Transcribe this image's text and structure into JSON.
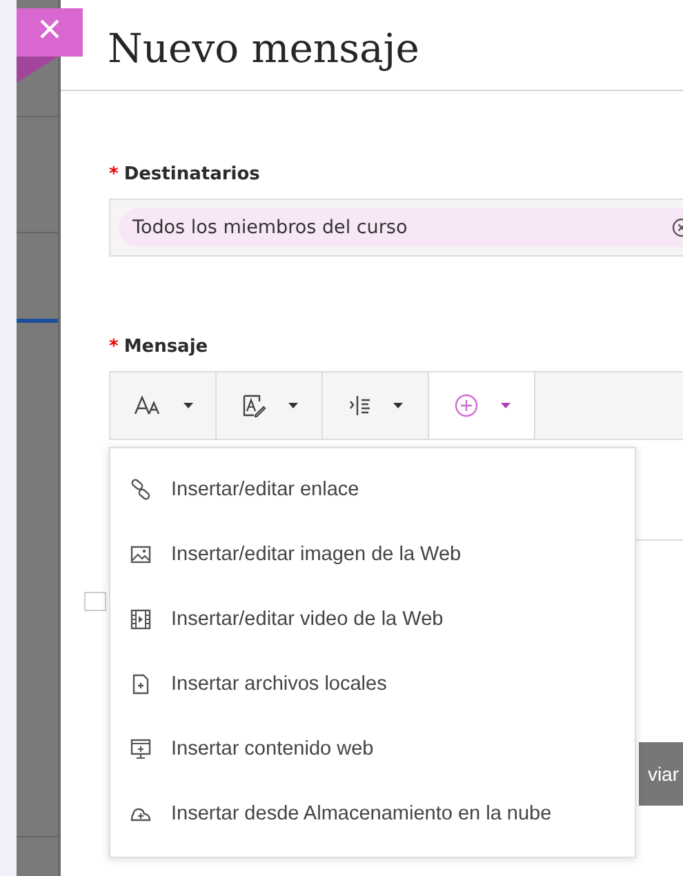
{
  "dialog": {
    "title": "Nuevo mensaje"
  },
  "recipients": {
    "label": "Destinatarios",
    "required_mark": "*",
    "chips": [
      {
        "text": "Todos los miembros del curso"
      }
    ]
  },
  "message": {
    "label": "Mensaje",
    "required_mark": "*"
  },
  "toolbar": {
    "groups": [
      {
        "kind": "font",
        "selected": false
      },
      {
        "kind": "style",
        "selected": false
      },
      {
        "kind": "paragraph",
        "selected": false
      },
      {
        "kind": "insert",
        "selected": true
      }
    ]
  },
  "insert_menu": {
    "items": [
      {
        "kind": "link",
        "label": "Insertar/editar enlace"
      },
      {
        "kind": "image",
        "label": "Insertar/editar imagen de la Web"
      },
      {
        "kind": "video",
        "label": "Insertar/editar video de la Web"
      },
      {
        "kind": "file",
        "label": "Insertar archivos locales"
      },
      {
        "kind": "web",
        "label": "Insertar contenido web"
      },
      {
        "kind": "cloud",
        "label": "Insertar desde Almacenamiento en la nube"
      }
    ]
  },
  "option_checkbox": {
    "checked": false
  },
  "send_button": {
    "label": "viar"
  }
}
